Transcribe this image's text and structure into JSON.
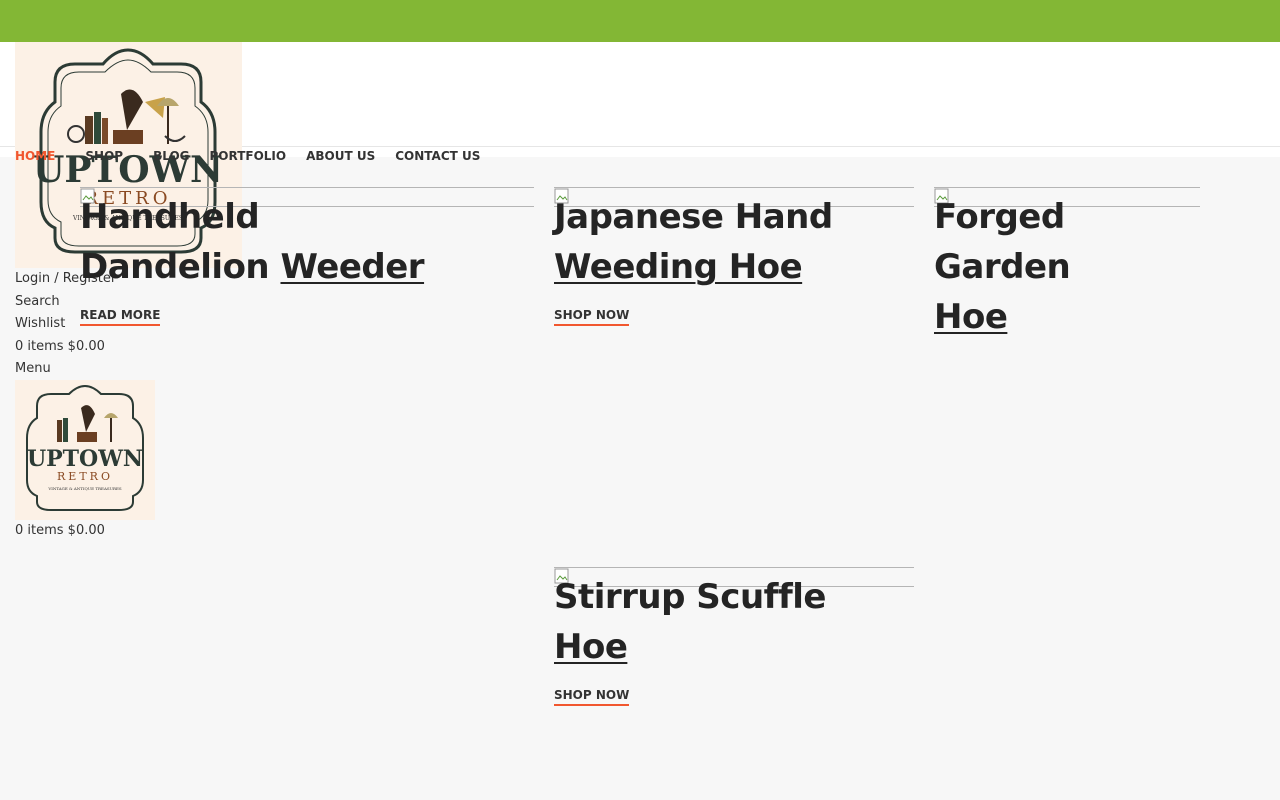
{
  "colors": {
    "topbar": "#83b735",
    "accent": "#f1572f",
    "text": "#242424",
    "background": "#f7f7f7"
  },
  "logo": {
    "line1": "UPTOWN",
    "line2": "RETRO",
    "tagline": "VINTAGE & ANTIQUE TREASURES"
  },
  "nav": {
    "items": [
      {
        "label": "HOME",
        "active": true
      },
      {
        "label": "SHOP"
      },
      {
        "label": "BLOG"
      },
      {
        "label": "PORTFOLIO"
      },
      {
        "label": "ABOUT US"
      },
      {
        "label": "CONTACT US"
      }
    ]
  },
  "header_tools": {
    "login": "Login / Register",
    "search": "Search",
    "wishlist": "Wishlist",
    "cart": "0 items $0.00",
    "menu": "Menu"
  },
  "mobile_header": {
    "cart": "0 items $0.00"
  },
  "products": [
    {
      "title_line1": "Handheld",
      "title_line2_plain": "Dandelion ",
      "title_line2_link": "Weeder",
      "cta": "READ MORE"
    },
    {
      "title_line1": "Japanese Hand",
      "title_line2_plain": "",
      "title_line2_link": "Weeding Hoe",
      "cta": "SHOP NOW"
    },
    {
      "title_line1": "Forged Garden",
      "title_line2_plain": "",
      "title_line2_link": "Hoe",
      "cta": ""
    },
    {
      "title_line1": "Stirrup Scuffle",
      "title_line2_plain": "",
      "title_line2_link": "Hoe",
      "cta": "SHOP NOW"
    }
  ]
}
